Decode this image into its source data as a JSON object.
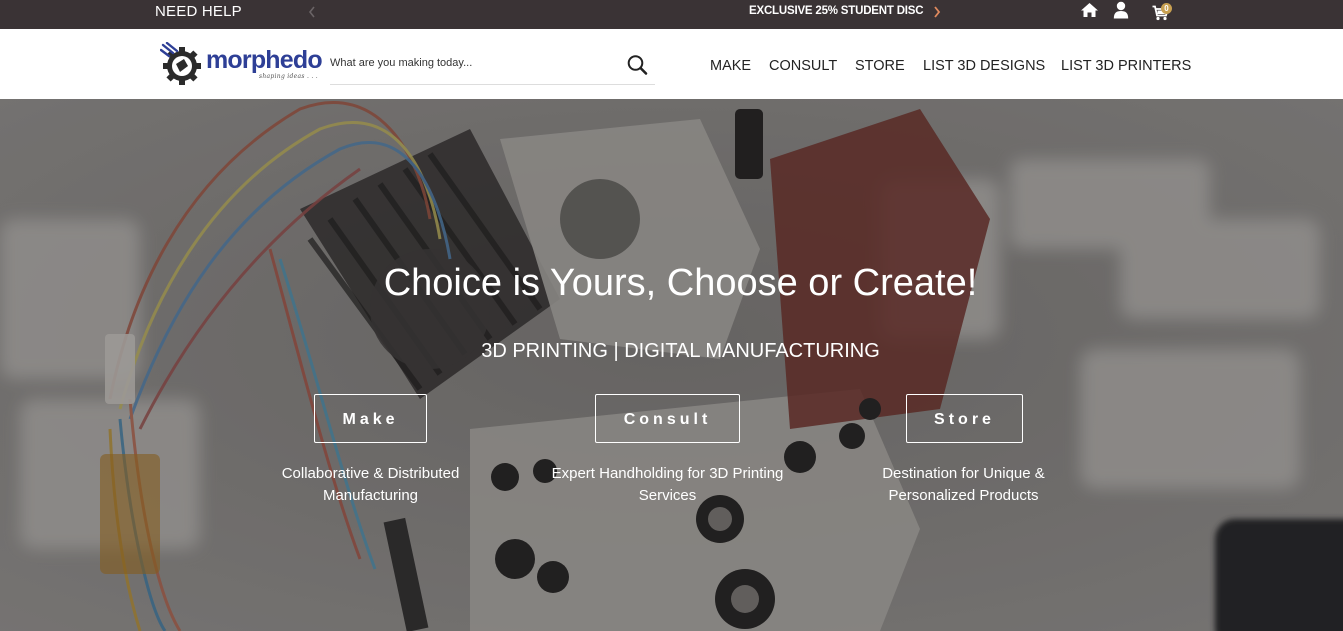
{
  "topbar": {
    "need_help": "NEED HELP",
    "promo_text": "EXCLUSIVE 25% STUDENT DISC",
    "cart_count": "0"
  },
  "header": {
    "logo_word": "morphedo",
    "logo_tagline": "shaping ideas . . .",
    "search_placeholder": "What are you making today...",
    "nav": [
      "MAKE",
      "CONSULT",
      "STORE",
      "LIST 3D DESIGNS",
      "LIST 3D PRINTERS"
    ]
  },
  "hero": {
    "title": "Choice is Yours, Choose or Create!",
    "subtitle": "3D PRINTING | DIGITAL MANUFACTURING",
    "ctas": [
      {
        "label": "Make",
        "desc_line1": "Collaborative & Distributed",
        "desc_line2": "Manufacturing"
      },
      {
        "label": "Consult",
        "desc_line1": "Expert Handholding for 3D Printing",
        "desc_line2": "Services"
      },
      {
        "label": "Store",
        "desc_line1": "Destination for Unique &",
        "desc_line2": "Personalized Products"
      }
    ]
  },
  "colors": {
    "topbar_bg": "#3a3335",
    "brand_blue": "#2e3f96",
    "cart_badge": "#c8a051"
  },
  "icons": [
    "chevron-left-icon",
    "chevron-right-icon",
    "home-icon",
    "user-icon",
    "cart-icon",
    "search-icon",
    "logo-gear-icon"
  ]
}
